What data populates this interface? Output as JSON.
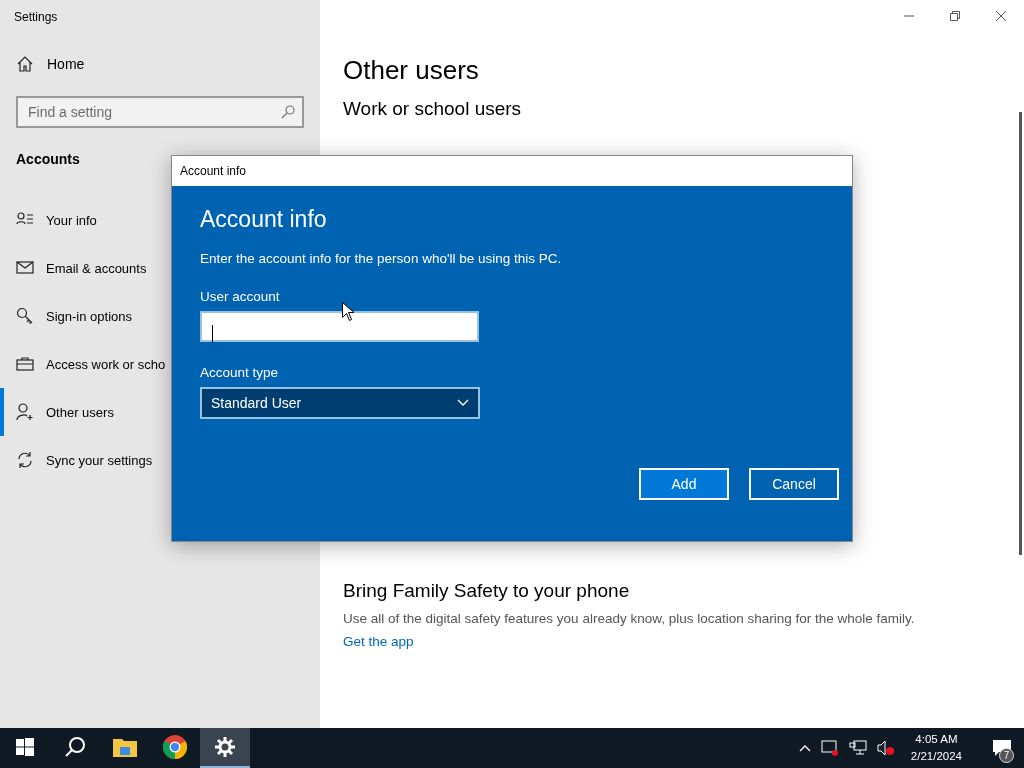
{
  "window": {
    "title": "Settings"
  },
  "sidebar": {
    "home": "Home",
    "search": {
      "placeholder": "Find a setting"
    },
    "section": "Accounts",
    "items": [
      {
        "label": "Your info",
        "selected": false
      },
      {
        "label": "Email & accounts",
        "selected": false
      },
      {
        "label": "Sign-in options",
        "selected": false
      },
      {
        "label": "Access work or scho",
        "selected": false
      },
      {
        "label": "Other users",
        "selected": true
      },
      {
        "label": "Sync your settings",
        "selected": false
      }
    ]
  },
  "content": {
    "title": "Other users",
    "subtitle": "Work or school users",
    "family": {
      "title": "Bring Family Safety to your phone",
      "text": "Use all of the digital safety features you already know, plus location sharing for the whole family.",
      "link": "Get the app"
    }
  },
  "dialog": {
    "title": "Account info",
    "heading": "Account info",
    "intro": "Enter the account info for the person who'll be using this PC.",
    "user_label": "User account",
    "type_label": "Account type",
    "type_value": "Standard User",
    "buttons": [
      "Add",
      "Cancel"
    ]
  },
  "taskbar": {
    "apps": [
      {
        "selected": false
      },
      {
        "selected": false
      },
      {
        "selected": false
      },
      {
        "selected": false
      },
      {
        "selected": true
      }
    ],
    "time": "4:05 AM",
    "date": "2/21/2024",
    "notifications": "7"
  }
}
